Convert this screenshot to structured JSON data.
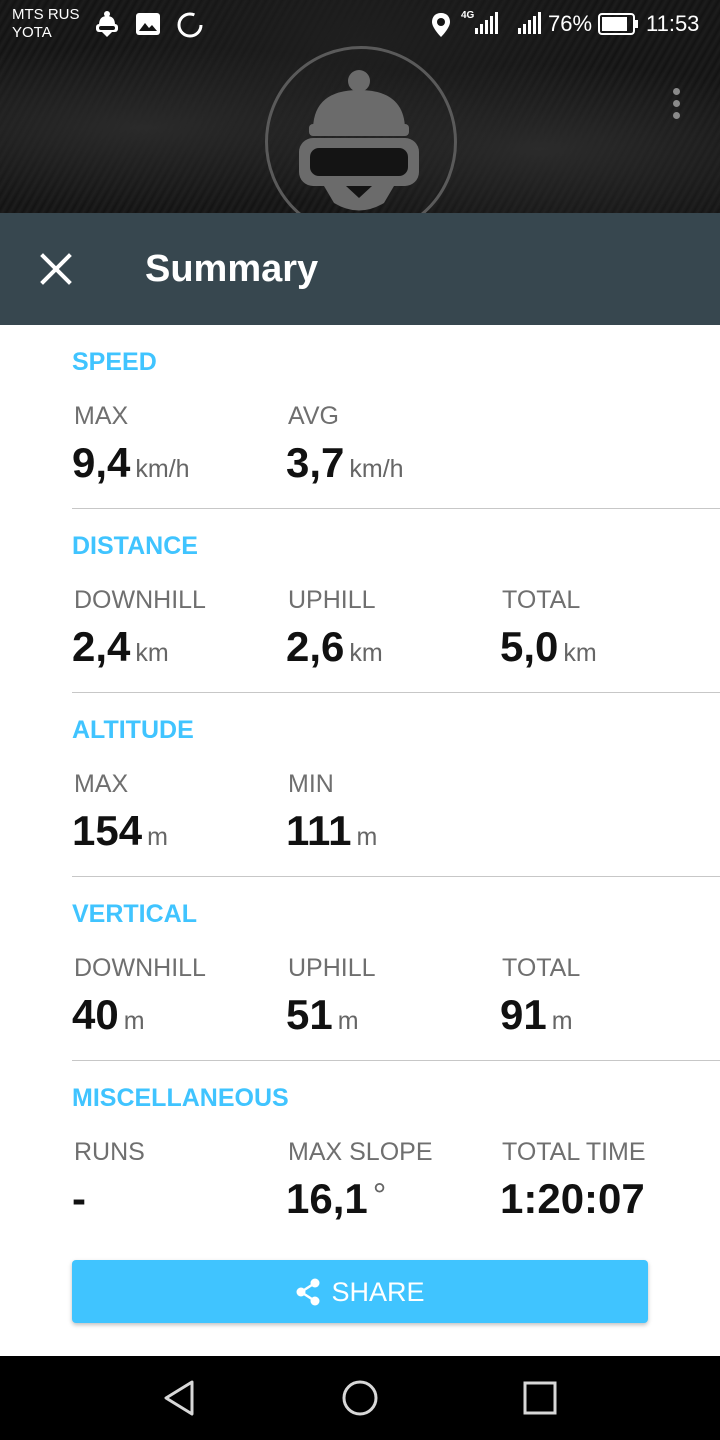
{
  "status_bar": {
    "carrier_line1": "MTS RUS",
    "carrier_line2": "YOTA",
    "network_label": "4G",
    "battery_percent": "76%",
    "time": "11:53"
  },
  "header": {
    "title": "Summary"
  },
  "sections": [
    {
      "title": "SPEED",
      "stats": [
        {
          "label": "MAX",
          "value": "9,4",
          "unit": "km/h"
        },
        {
          "label": "AVG",
          "value": "3,7",
          "unit": "km/h"
        }
      ]
    },
    {
      "title": "DISTANCE",
      "stats": [
        {
          "label": "DOWNHILL",
          "value": "2,4",
          "unit": "km"
        },
        {
          "label": "UPHILL",
          "value": "2,6",
          "unit": "km"
        },
        {
          "label": "TOTAL",
          "value": "5,0",
          "unit": "km"
        }
      ]
    },
    {
      "title": "ALTITUDE",
      "stats": [
        {
          "label": "MAX",
          "value": "154",
          "unit": "m"
        },
        {
          "label": "MIN",
          "value": "111",
          "unit": "m"
        }
      ]
    },
    {
      "title": "VERTICAL",
      "stats": [
        {
          "label": "DOWNHILL",
          "value": "40",
          "unit": "m"
        },
        {
          "label": "UPHILL",
          "value": "51",
          "unit": "m"
        },
        {
          "label": "TOTAL",
          "value": "91",
          "unit": "m"
        }
      ]
    },
    {
      "title": "MISCELLANEOUS",
      "stats": [
        {
          "label": "RUNS",
          "value": "-",
          "unit": ""
        },
        {
          "label": "MAX SLOPE",
          "value": "16,1",
          "unit": "°"
        },
        {
          "label": "TOTAL TIME",
          "value": "1:20:07",
          "unit": ""
        }
      ]
    }
  ],
  "share_button": {
    "label": "SHARE"
  },
  "colors": {
    "accent": "#40c4ff",
    "titlebar": "#37474f",
    "navbar": "#000000"
  },
  "icons": {
    "avatar": "skier-beanie-goggles-icon",
    "close": "close-icon",
    "more": "more-vert-icon",
    "share": "share-icon",
    "nav_back": "back-triangle-icon",
    "nav_home": "home-circle-icon",
    "nav_recents": "recents-square-icon"
  }
}
